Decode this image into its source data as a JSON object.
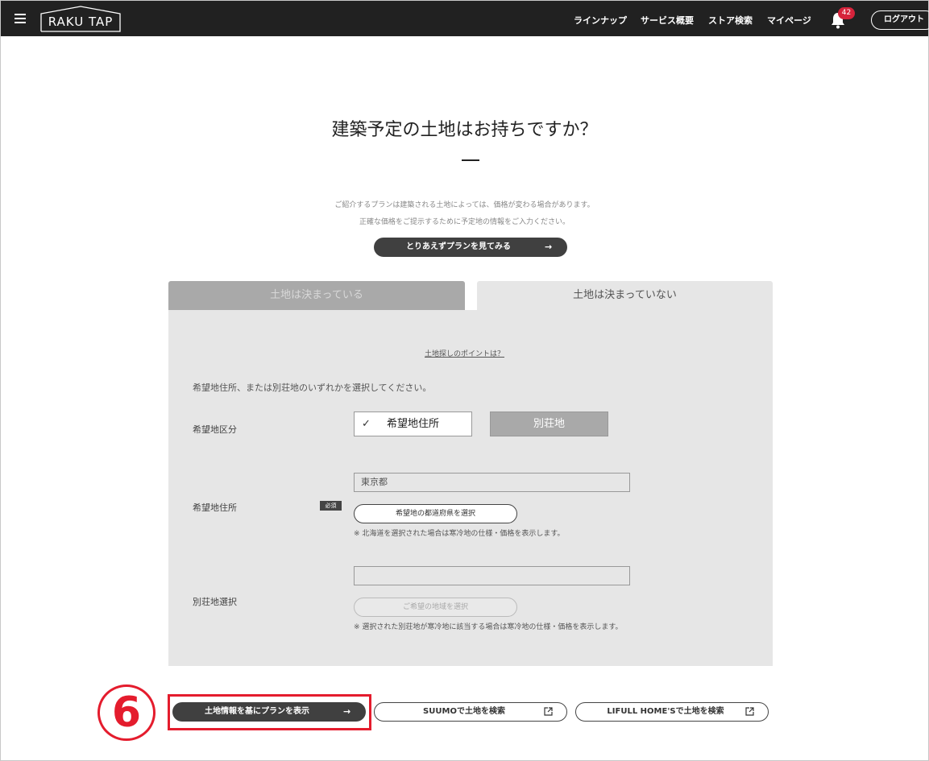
{
  "header": {
    "logo_text": "RAKU TAP",
    "nav": [
      "ラインナップ",
      "サービス概要",
      "ストア検索",
      "マイページ"
    ],
    "notification_count": "42",
    "logout_label": "ログアウト"
  },
  "intro": {
    "title": "建築予定の土地はお持ちですか？",
    "note_line1": "ご紹介するプランは建築される土地によっては、価格が変わる場合があります。",
    "note_line2": "正確な価格をご提示するために予定地の情報をご入力ください。",
    "skip_button": "とりあえずプランを見てみる",
    "arrow": "→"
  },
  "tabs": [
    {
      "label": "土地は決まっている",
      "active": false
    },
    {
      "label": "土地は決まっていない",
      "active": true
    }
  ],
  "form": {
    "tips_link": "土地探しのポイントは？",
    "instruction": "希望地住所、または別荘地のいずれかを選択してください。",
    "category_label": "希望地区分",
    "category_options": [
      {
        "label": "希望地住所",
        "selected": true
      },
      {
        "label": "別荘地",
        "selected": false
      }
    ],
    "check_mark": "✓",
    "address_label": "希望地住所",
    "required_badge": "必須",
    "address_value": "東京都",
    "address_button": "希望地の都道府県を選択",
    "address_note": "※ 北海道を選択された場合は寒冷地の仕様・価格を表示します。",
    "villa_label": "別荘地選択",
    "villa_value": "",
    "villa_button": "ご希望の地域を選択",
    "villa_note": "※ 選択された別荘地が寒冷地に該当する場合は寒冷地の仕様・価格を表示します。"
  },
  "actions": {
    "show_plan": "土地情報を基にプランを表示",
    "suumo": "SUUMOで土地を検索",
    "lifull": "LIFULL HOME'Sで土地を検索"
  },
  "annotation": {
    "step_number": "6",
    "color": "#e41c2d"
  }
}
